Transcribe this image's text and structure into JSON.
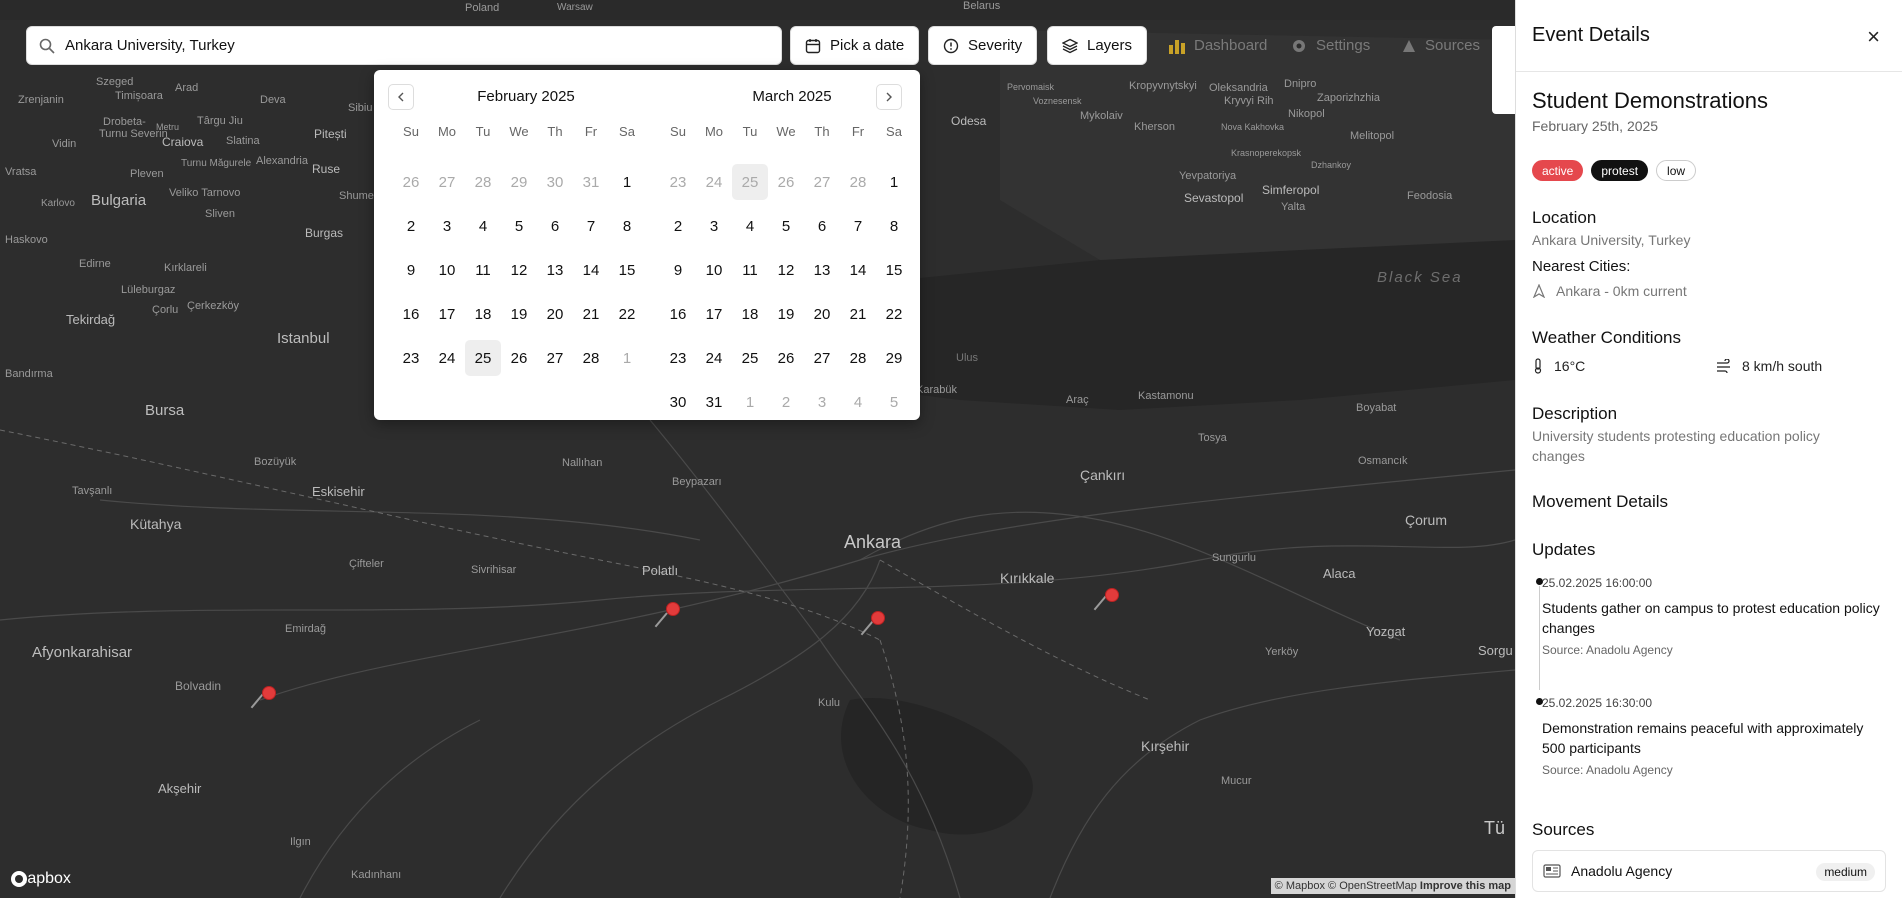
{
  "search": {
    "value": "Ankara University, Turkey"
  },
  "toolbar": {
    "date_label": "Pick a date",
    "severity_label": "Severity",
    "layers_label": "Layers",
    "dashboard_label": "Dashboard",
    "settings_label": "Settings",
    "sources_label": "Sources"
  },
  "calendar": {
    "weekdays": [
      "Su",
      "Mo",
      "Tu",
      "We",
      "Th",
      "Fr",
      "Sa"
    ],
    "months": [
      {
        "title": "February 2025",
        "weeks": [
          [
            "26",
            "27",
            "28",
            "29",
            "30",
            "31",
            "1"
          ],
          [
            "2",
            "3",
            "4",
            "5",
            "6",
            "7",
            "8"
          ],
          [
            "9",
            "10",
            "11",
            "12",
            "13",
            "14",
            "15"
          ],
          [
            "16",
            "17",
            "18",
            "19",
            "20",
            "21",
            "22"
          ],
          [
            "23",
            "24",
            "25",
            "26",
            "27",
            "28",
            "1"
          ]
        ],
        "outside": [
          [
            0,
            0
          ],
          [
            0,
            1
          ],
          [
            0,
            2
          ],
          [
            0,
            3
          ],
          [
            0,
            4
          ],
          [
            0,
            5
          ],
          [
            4,
            6
          ]
        ],
        "selected": [
          [
            4,
            2
          ]
        ]
      },
      {
        "title": "March 2025",
        "weeks": [
          [
            "23",
            "24",
            "25",
            "26",
            "27",
            "28",
            "1"
          ],
          [
            "2",
            "3",
            "4",
            "5",
            "6",
            "7",
            "8"
          ],
          [
            "9",
            "10",
            "11",
            "12",
            "13",
            "14",
            "15"
          ],
          [
            "16",
            "17",
            "18",
            "19",
            "20",
            "21",
            "22"
          ],
          [
            "23",
            "24",
            "25",
            "26",
            "27",
            "28",
            "29"
          ],
          [
            "30",
            "31",
            "1",
            "2",
            "3",
            "4",
            "5"
          ]
        ],
        "outside": [
          [
            0,
            0
          ],
          [
            0,
            1
          ],
          [
            0,
            2
          ],
          [
            0,
            3
          ],
          [
            0,
            4
          ],
          [
            0,
            5
          ],
          [
            5,
            2
          ],
          [
            5,
            3
          ],
          [
            5,
            4
          ],
          [
            5,
            5
          ],
          [
            5,
            6
          ]
        ],
        "selected": [
          [
            0,
            2
          ]
        ]
      }
    ]
  },
  "map": {
    "places": [
      "Poland",
      "Warsaw",
      "Belarus",
      "Szeged",
      "Timișoara",
      "Arad",
      "Deva",
      "Sibiu",
      "Zrenjanin",
      "Drobeta-Turnu Severin",
      "Târgu Jiu",
      "Craiova",
      "Slatina",
      "Vidin",
      "Metru",
      "Pitești",
      "Ruse",
      "Turnu Măgurele",
      "Alexandria",
      "Vratsa",
      "Pleven",
      "Veliko Tarnovo",
      "Karlovo",
      "Bulgaria",
      "Sliven",
      "Shumen",
      "Haskovo",
      "Burgas",
      "Edirne",
      "Kırklareli",
      "Lüleburgaz",
      "Çorlu",
      "Çerkezköy",
      "Tekirdağ",
      "Istanbul",
      "Bandırma",
      "Bursa",
      "Bozüyük",
      "Eskisehir",
      "Tavşanlı",
      "Kütahya",
      "Çifteler",
      "Emirdağ",
      "Afyonkarahisar",
      "Bolvadin",
      "Akşehir",
      "Ilgın",
      "Kadınhanı",
      "Odesa",
      "Mykolaiv",
      "Kherson",
      "Kropyvnytskyi",
      "Oleksandria",
      "Kryvyi Rih",
      "Dnipro",
      "Zaporizhzhia",
      "Nikopol",
      "Melitopol",
      "Nova Kakhovka",
      "Krasnoperekopsk",
      "Dzhankoy",
      "Yevpatoriya",
      "Simferopol",
      "Sevastopol",
      "Yalta",
      "Feodosia",
      "Black Sea",
      "Karabük",
      "Kastamonu",
      "Araç",
      "Ulus",
      "Tosya",
      "Boyabat",
      "Osmancık",
      "Çorum",
      "Çankırı",
      "Ankara",
      "Polatlı",
      "Nallıhan",
      "Beypazarı",
      "Sivrihisar",
      "Kırıkkale",
      "Sungurlu",
      "Alaca",
      "Yozgat",
      "Yerköy",
      "Kulu",
      "Kırşehir",
      "Mucur",
      "Sorgu",
      "Tü",
      "Perivomaisk",
      "Voznesensk"
    ],
    "logo": "mapbox",
    "attribution": [
      "© Mapbox",
      "© OpenStreetMap",
      "Improve this map"
    ]
  },
  "details": {
    "header": "Event Details",
    "close": "×",
    "title": "Student Demonstrations",
    "date": "February 25th, 2025",
    "badges": [
      {
        "label": "active",
        "color": "#e5484d"
      },
      {
        "label": "protest",
        "color": "#111111"
      },
      {
        "label": "low",
        "color": "#ffffff"
      }
    ],
    "location_heading": "Location",
    "location": "Ankara University, Turkey",
    "nearest_heading": "Nearest Cities:",
    "nearest": "Ankara - 0km current",
    "weather_heading": "Weather Conditions",
    "temperature": "16°C",
    "wind": "8 km/h south",
    "description_heading": "Description",
    "description": "University students protesting education policy changes",
    "movement_heading": "Movement Details",
    "updates_heading": "Updates",
    "updates": [
      {
        "time": "25.02.2025 16:00:00",
        "text": "Students gather on campus to protest education policy changes",
        "source": "Source: Anadolu Agency"
      },
      {
        "time": "25.02.2025 16:30:00",
        "text": "Demonstration remains peaceful with approximately 500 participants",
        "source": "Source: Anadolu Agency"
      }
    ],
    "sources_heading": "Sources",
    "source_card": {
      "name": "Anadolu Agency",
      "level": "medium"
    }
  }
}
